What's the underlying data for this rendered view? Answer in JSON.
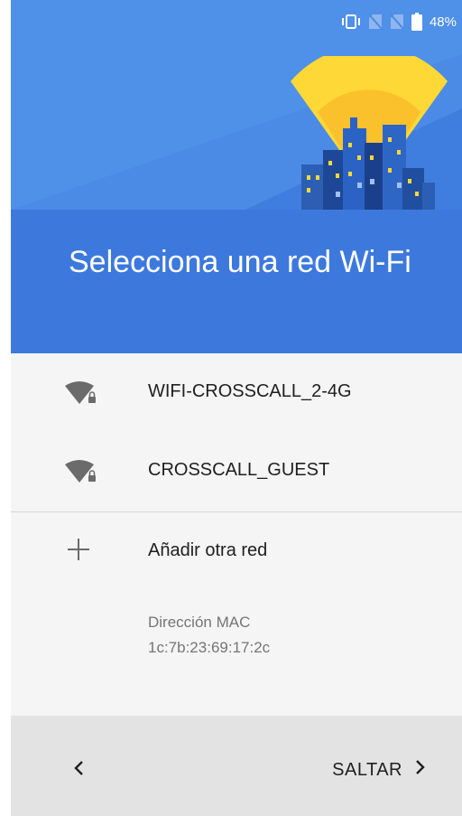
{
  "status_bar": {
    "battery_text": "48%",
    "icons": [
      "vibrate-icon",
      "no-sim-icon",
      "no-sim-icon",
      "battery-icon"
    ]
  },
  "header": {
    "title": "Selecciona una red Wi-Fi",
    "colors": {
      "top": "#4b8be6",
      "bottom": "#3d79dc",
      "accent": "#fcd535"
    }
  },
  "networks": [
    {
      "ssid": "WIFI-CROSSCALL_2-4G",
      "icon": "wifi-lock-icon"
    },
    {
      "ssid": "CROSSCALL_GUEST",
      "icon": "wifi-lock-icon"
    }
  ],
  "add_network": {
    "label": "Añadir otra red",
    "icon": "plus-icon"
  },
  "mac": {
    "label": "Dirección MAC",
    "value": "1c:7b:23:69:17:2c"
  },
  "nav": {
    "back_icon": "chevron-left-icon",
    "skip_label": "SALTAR",
    "skip_icon": "chevron-right-icon"
  }
}
